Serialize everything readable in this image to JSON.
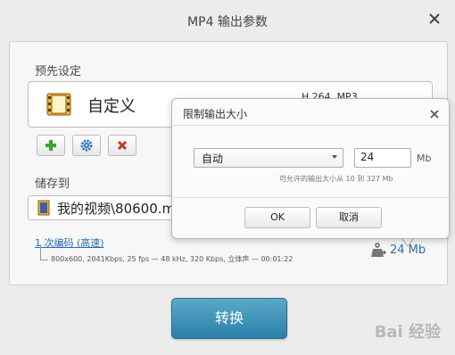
{
  "window": {
    "title": "MP4 输出参数"
  },
  "preset": {
    "section_label": "预先设定",
    "name": "自定义",
    "codec": "H.264, MP3"
  },
  "save": {
    "section_label": "储存到",
    "path": "我的视频\\80600.mp4"
  },
  "encoding": {
    "link": "1 次编码 (高速)",
    "details": "800x600, 2041Kbps, 25 fps — 48 kHz, 320 Kbps, 立体声 — 00:01:22"
  },
  "size_limit": {
    "value": "24 Mb"
  },
  "convert_label": "转换",
  "dialog": {
    "title": "限制输出大小",
    "mode_selected": "自动",
    "size_value": "24",
    "unit": "Mb",
    "hint": "可允许的输出大小从 10 到 327 Mb",
    "ok_label": "OK",
    "cancel_label": "取消"
  },
  "watermark": "Bai 经验",
  "colors": {
    "accent": "#2a7fa8",
    "link": "#2a6db3",
    "add": "#3aa339",
    "settings": "#2f74c0",
    "delete": "#c0392b"
  },
  "icons": [
    "close-icon",
    "film-icon",
    "plus-icon",
    "gear-icon",
    "delete-icon",
    "file-icon",
    "weight-icon"
  ]
}
